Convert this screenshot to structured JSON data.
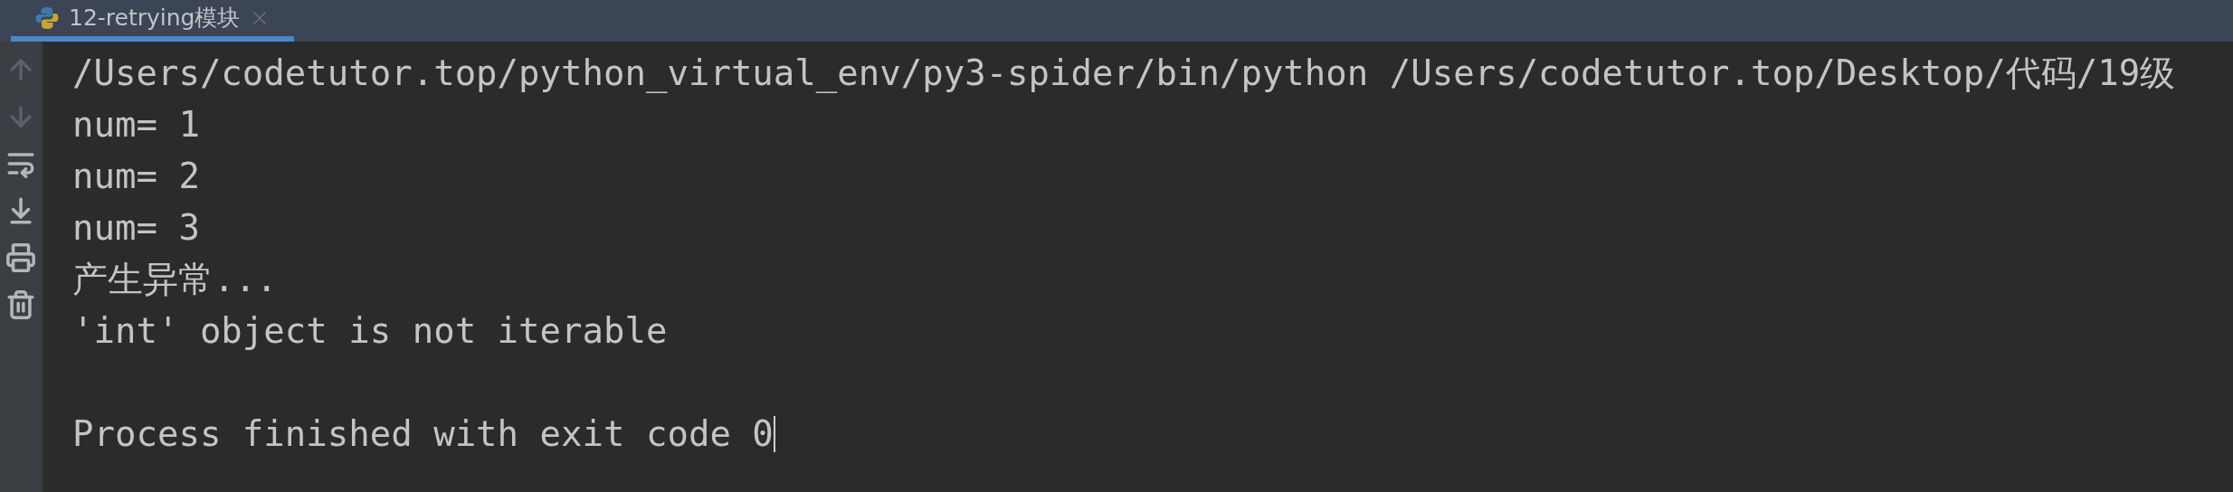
{
  "tabs": [
    {
      "label": "12-retrying模块",
      "selected": true,
      "closable": true
    }
  ],
  "toolbar": [
    {
      "kind": "up",
      "disabled": true
    },
    {
      "kind": "down",
      "disabled": true
    },
    {
      "kind": "wrap",
      "disabled": false
    },
    {
      "kind": "scroll-end",
      "disabled": false
    },
    {
      "kind": "print",
      "disabled": false
    },
    {
      "kind": "trash",
      "disabled": false
    }
  ],
  "console": {
    "lines": [
      {
        "kind": "text",
        "text": "/Users/codetutor.top/python_virtual_env/py3-spider/bin/python /Users/codetutor.top/Desktop/代码/19级"
      },
      {
        "kind": "text",
        "text": "num= 1"
      },
      {
        "kind": "text",
        "text": "num= 2"
      },
      {
        "kind": "text",
        "text": "num= 3"
      },
      {
        "kind": "text",
        "text": "产生异常..."
      },
      {
        "kind": "text",
        "text": "'int' object is not iterable"
      },
      {
        "kind": "blank"
      },
      {
        "kind": "text",
        "text": "Process finished with exit code 0"
      }
    ]
  }
}
